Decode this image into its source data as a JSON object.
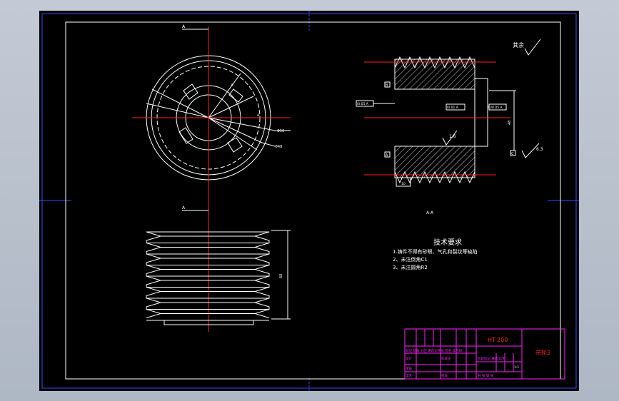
{
  "section_markers": {
    "top_label": "A",
    "bottom_label": "A",
    "section_title": "A-A"
  },
  "dimensions": {
    "slot_width": "4",
    "slot_angle": "4",
    "dim_dia_right": "Φ50",
    "dim_dia_lower": "Φ48",
    "tolerance_frame_left": "Ⅰ0.05 A",
    "tolerance_frame_center": "Ⅰ0.01 A",
    "tolerance_frame_right": "//0.05 A",
    "roughness_bore": "1.6",
    "roughness_side": "6.3",
    "datum_b": "B",
    "datum_a": "A",
    "datum_c": "C",
    "vertical_dim_right": "48",
    "height_dim_front": "60",
    "bore_dim": "10"
  },
  "remaining_surface": "其余",
  "technical_requirements": {
    "title": "技术要求",
    "items": [
      "1.铸件不得有砂眼、气孔和裂纹等缺陷",
      "2、未注倒角C1",
      "3、未注圆角R2"
    ]
  },
  "title_block": {
    "material": "HT-200",
    "part_name": "带轮3",
    "row_left": "标记 处数 分区 更改文件号 签名 年月日",
    "designer": "设计",
    "standardization": "标准化",
    "reviewer": "审核",
    "process": "工艺",
    "approve": "批准",
    "stage_header": "阶段标记 重量 比例",
    "scale": "1:1",
    "sheet_info": "共  张  第  张"
  },
  "colors": {
    "background": "#000000",
    "lines": "#ffffff",
    "centerline": "#ff2020",
    "title_block": "#ff20ff",
    "frame_blue": "#3050ff"
  }
}
